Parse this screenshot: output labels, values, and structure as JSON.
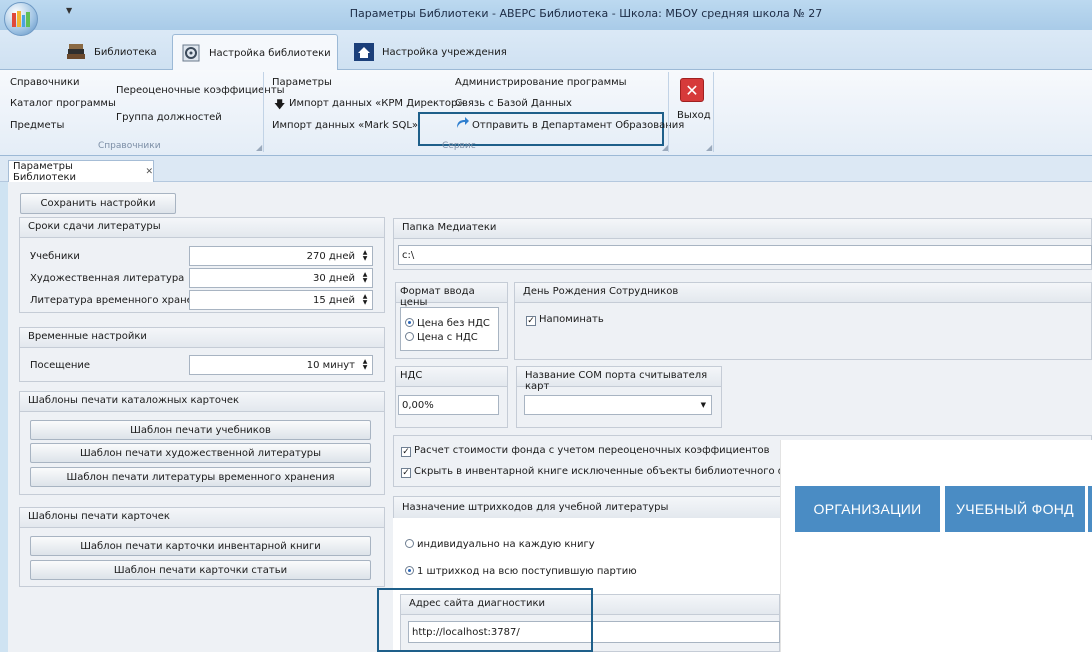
{
  "window": {
    "title": "Параметры Библиотеки - АВЕРС Библиотека - Школа: МБОУ средняя школа  № 27"
  },
  "ribbon_tabs": [
    {
      "label": "Библиотека",
      "icon": "books-icon",
      "active": false
    },
    {
      "label": "Настройка библиотеки",
      "icon": "settings-books-icon",
      "active": true
    },
    {
      "label": "Настройка учреждения",
      "icon": "home-icon",
      "active": false
    }
  ],
  "ribbon": {
    "directories": {
      "items": [
        "Справочники",
        "Каталог программы",
        "Предметы"
      ],
      "items2": [
        "Переоценочные коэффициенты",
        "Группа должностей"
      ],
      "group_label": "Справочники"
    },
    "service": {
      "params": "Параметры",
      "import_krm": "Импорт данных «КРМ Директор»",
      "import_mark": "Импорт данных «Mark SQL»",
      "admin": "Администрирование программы",
      "db_link": "Связь с Базой Данных",
      "send_dept": "Отправить в Департамент Образования",
      "group_label": "Сервис"
    },
    "exit_label": "Выход"
  },
  "doc_tab": {
    "label": "Параметры Библиотеки",
    "close": "✕"
  },
  "save_button": "Сохранить настройки",
  "return_terms": {
    "title": "Сроки сдачи литературы",
    "rows": [
      {
        "label": "Учебники",
        "value": "270 дней"
      },
      {
        "label": "Художественная литература",
        "value": "30 дней"
      },
      {
        "label": "Литература временного хранения",
        "value": "15 дней"
      }
    ]
  },
  "time_settings": {
    "title": "Временные настройки",
    "rows": [
      {
        "label": "Посещение",
        "value": "10 минут"
      }
    ]
  },
  "catalog_templates": {
    "title": "Шаблоны печати каталожных карточек",
    "buttons": [
      "Шаблон печати учебников",
      "Шаблон печати художественной литературы",
      "Шаблон печати литературы временного хранения"
    ]
  },
  "card_templates": {
    "title": "Шаблоны печати карточек",
    "buttons": [
      "Шаблон печати карточки инвентарной книги",
      "Шаблон печати карточки статьи"
    ]
  },
  "media_folder": {
    "title": "Папка Медиатеки",
    "value": "c:\\"
  },
  "price_format": {
    "title": "Формат ввода цены",
    "options": [
      "Цена без НДС",
      "Цена с НДС"
    ],
    "selected": 0
  },
  "birthday": {
    "title": "День Рождения Сотрудников",
    "remind_label": "Напоминать",
    "checked": true
  },
  "vat": {
    "title": "НДС",
    "value": "0,00%"
  },
  "com_port": {
    "title": "Название COM порта считывателя карт",
    "value": ""
  },
  "options": [
    {
      "label": "Расчет стоимости фонда с учетом переоценочных коэффициентов",
      "checked": true
    },
    {
      "label": "Скрыть в инвентарной книге исключенные объекты библиотечного фонда",
      "checked": true
    }
  ],
  "barcodes": {
    "title": "Назначение штрихкодов для учебной литературы",
    "options": [
      "индивидуально на каждую книгу",
      "1 штрихкод на всю поступившую партию"
    ],
    "selected": 1
  },
  "diagnostics": {
    "title": "Адрес сайта диагностики",
    "value": "http://localhost:3787/"
  },
  "overlay": {
    "buttons": [
      "ОРГАНИЗАЦИИ",
      "УЧЕБНЫЙ ФОНД"
    ]
  },
  "colors": {
    "accent": "#1e5f8a",
    "overlay_button": "#4a8cc4",
    "exit_red": "#d63a3a"
  }
}
